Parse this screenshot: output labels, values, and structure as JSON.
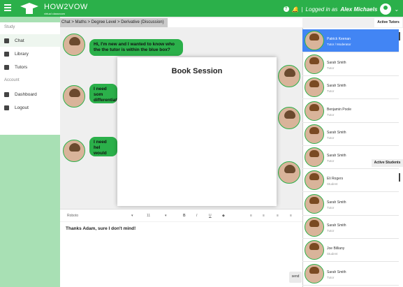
{
  "header": {
    "logo_text": "HOW2VOW",
    "logo_sub": "virtual classroom",
    "logged_in_prefix": "Logged in as",
    "user_name": "Alex Michaels",
    "accent": "#2bb04a"
  },
  "sidebar": {
    "section_study": "Study",
    "section_account": "Account",
    "items": [
      {
        "label": "Chat",
        "icon": "chat-icon"
      },
      {
        "label": "Library",
        "icon": "library-icon"
      },
      {
        "label": "Tutors",
        "icon": "tutors-icon"
      },
      {
        "label": "Dashboard",
        "icon": "dashboard-icon"
      },
      {
        "label": "Logout",
        "icon": "logout-icon"
      }
    ]
  },
  "breadcrumb": "Chat > Maths > Degree Level > Derivative (Discussion)",
  "messages": [
    {
      "text": "Hi, I'm new and I wanted to know who the the tutor is within the blue box?"
    },
    {
      "text": "I need som differentiati derivative"
    },
    {
      "text": "I need hel would rec really goo"
    }
  ],
  "modal": {
    "title": "Book Session"
  },
  "editor": {
    "font": "Roboto",
    "size": "11",
    "text": "Thanks Adam, sure I don't mind!",
    "send_label": "send"
  },
  "tabs": {
    "tutors": "Active Tutors",
    "students": "Active Students"
  },
  "people": [
    {
      "name": "Patrick Keenan",
      "role": "Tutor / Moderator"
    },
    {
      "name": "Sarah Smith",
      "role": "Tutor"
    },
    {
      "name": "Sarah Smith",
      "role": "Tutor"
    },
    {
      "name": "Benjamin Poole",
      "role": "Tutor"
    },
    {
      "name": "Sarah Smith",
      "role": "Tutor"
    },
    {
      "name": "Sarah Smith",
      "role": "Tutor"
    },
    {
      "name": "Eli Rogers",
      "role": "Student"
    },
    {
      "name": "Sarah Smith",
      "role": "Tutor"
    },
    {
      "name": "Sarah Smith",
      "role": "Tutor"
    },
    {
      "name": "Joe Billiany",
      "role": "Student"
    },
    {
      "name": "Sarah Smith",
      "role": "Tutor"
    }
  ]
}
